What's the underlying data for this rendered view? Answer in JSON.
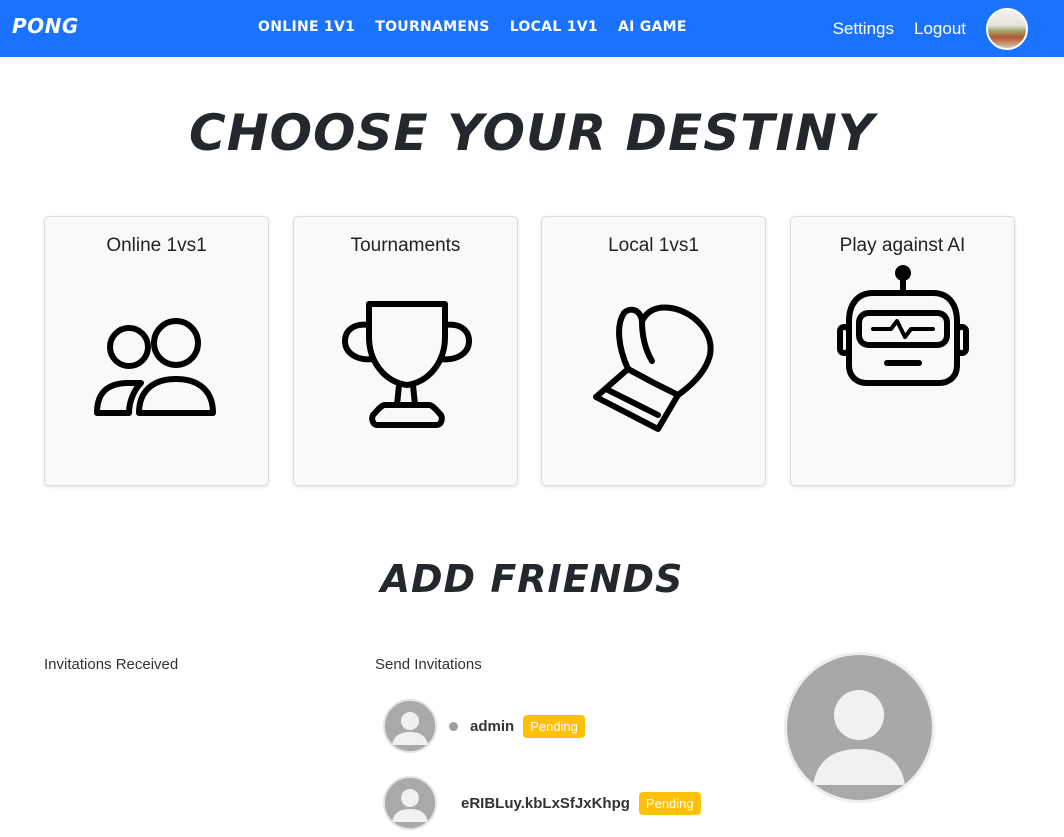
{
  "navbar": {
    "brand": "PONG",
    "links": [
      "ONLINE 1V1",
      "TOURNAMENS",
      "LOCAL 1V1",
      "AI GAME"
    ],
    "settings": "Settings",
    "logout": "Logout"
  },
  "main": {
    "title": "CHOOSE YOUR DESTINY",
    "cards": [
      {
        "label": "Online 1vs1",
        "icon": "users-icon"
      },
      {
        "label": "Tournaments",
        "icon": "trophy-icon"
      },
      {
        "label": "Local 1vs1",
        "icon": "boxing-glove-icon"
      },
      {
        "label": "Play against AI",
        "icon": "robot-icon"
      }
    ]
  },
  "friends": {
    "title": "ADD FRIENDS",
    "received_title": "Invitations Received",
    "send_title": "Send Invitations",
    "sent": [
      {
        "name": "admin",
        "status": "Pending"
      },
      {
        "name": "eRIBLuy.kbLxSfJxKhpg",
        "status": "Pending"
      }
    ]
  },
  "colors": {
    "navbar": "#1a73ff",
    "badge": "#ffc107",
    "title": "#24272b"
  }
}
